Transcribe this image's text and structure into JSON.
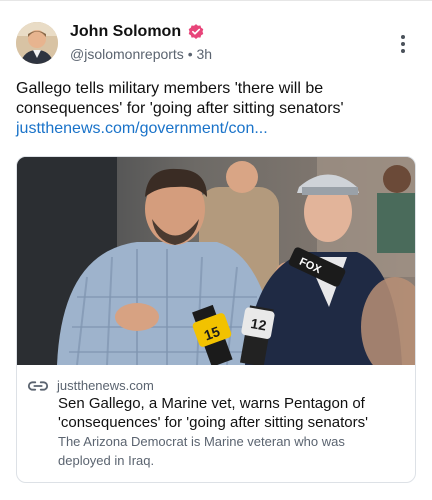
{
  "post": {
    "author_name": "John Solomon",
    "handle": "@jsolomonreports",
    "separator": "•",
    "time": "3h",
    "text_lines": [
      "Gallego tells military members 'there will be",
      "consequences' for 'going after sitting senators'"
    ],
    "link_text": "justthenews.com/government/con..."
  },
  "card": {
    "domain": "justthenews.com",
    "title_lines": [
      "Sen Gallego, a Marine vet, warns Pentagon of",
      "'consequences' for 'going after sitting senators'"
    ],
    "description_lines": [
      "The Arizona Democrat is Marine veteran who was",
      "deployed in Iraq."
    ],
    "image": {
      "mic_labels": [
        "15",
        "12",
        "FOX"
      ]
    }
  },
  "colors": {
    "link": "#1a73c9",
    "verified_badge": "#e8457a",
    "muted_text": "#5b6470",
    "card_border": "#dde1e6"
  },
  "icons": {
    "avatar": "author-avatar",
    "verified": "verified-badge-icon",
    "menu": "more-vertical-icon",
    "link": "link-icon"
  }
}
